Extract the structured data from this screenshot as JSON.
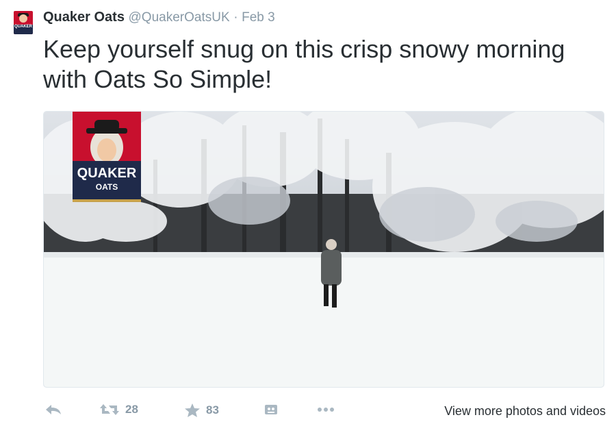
{
  "tweet": {
    "author_name": "Quaker Oats",
    "handle": "@QuakerOatsUK",
    "separator": "·",
    "date": "Feb 3",
    "text": "Keep yourself snug on this crisp snowy morning with Oats So Simple!"
  },
  "media": {
    "logo_line1": "QUAKER",
    "logo_line2": "OATS",
    "avatar_label": "QUAKER"
  },
  "actions": {
    "retweet_count": "28",
    "favorite_count": "83",
    "view_more_label": "View more photos and videos"
  },
  "colors": {
    "brand_red": "#c8102e",
    "brand_navy": "#1f2a4a",
    "action_gray": "#aab8c2",
    "meta_gray": "#8899a6"
  },
  "icons": [
    "reply-icon",
    "retweet-icon",
    "star-icon",
    "media-icon",
    "more-icon"
  ]
}
